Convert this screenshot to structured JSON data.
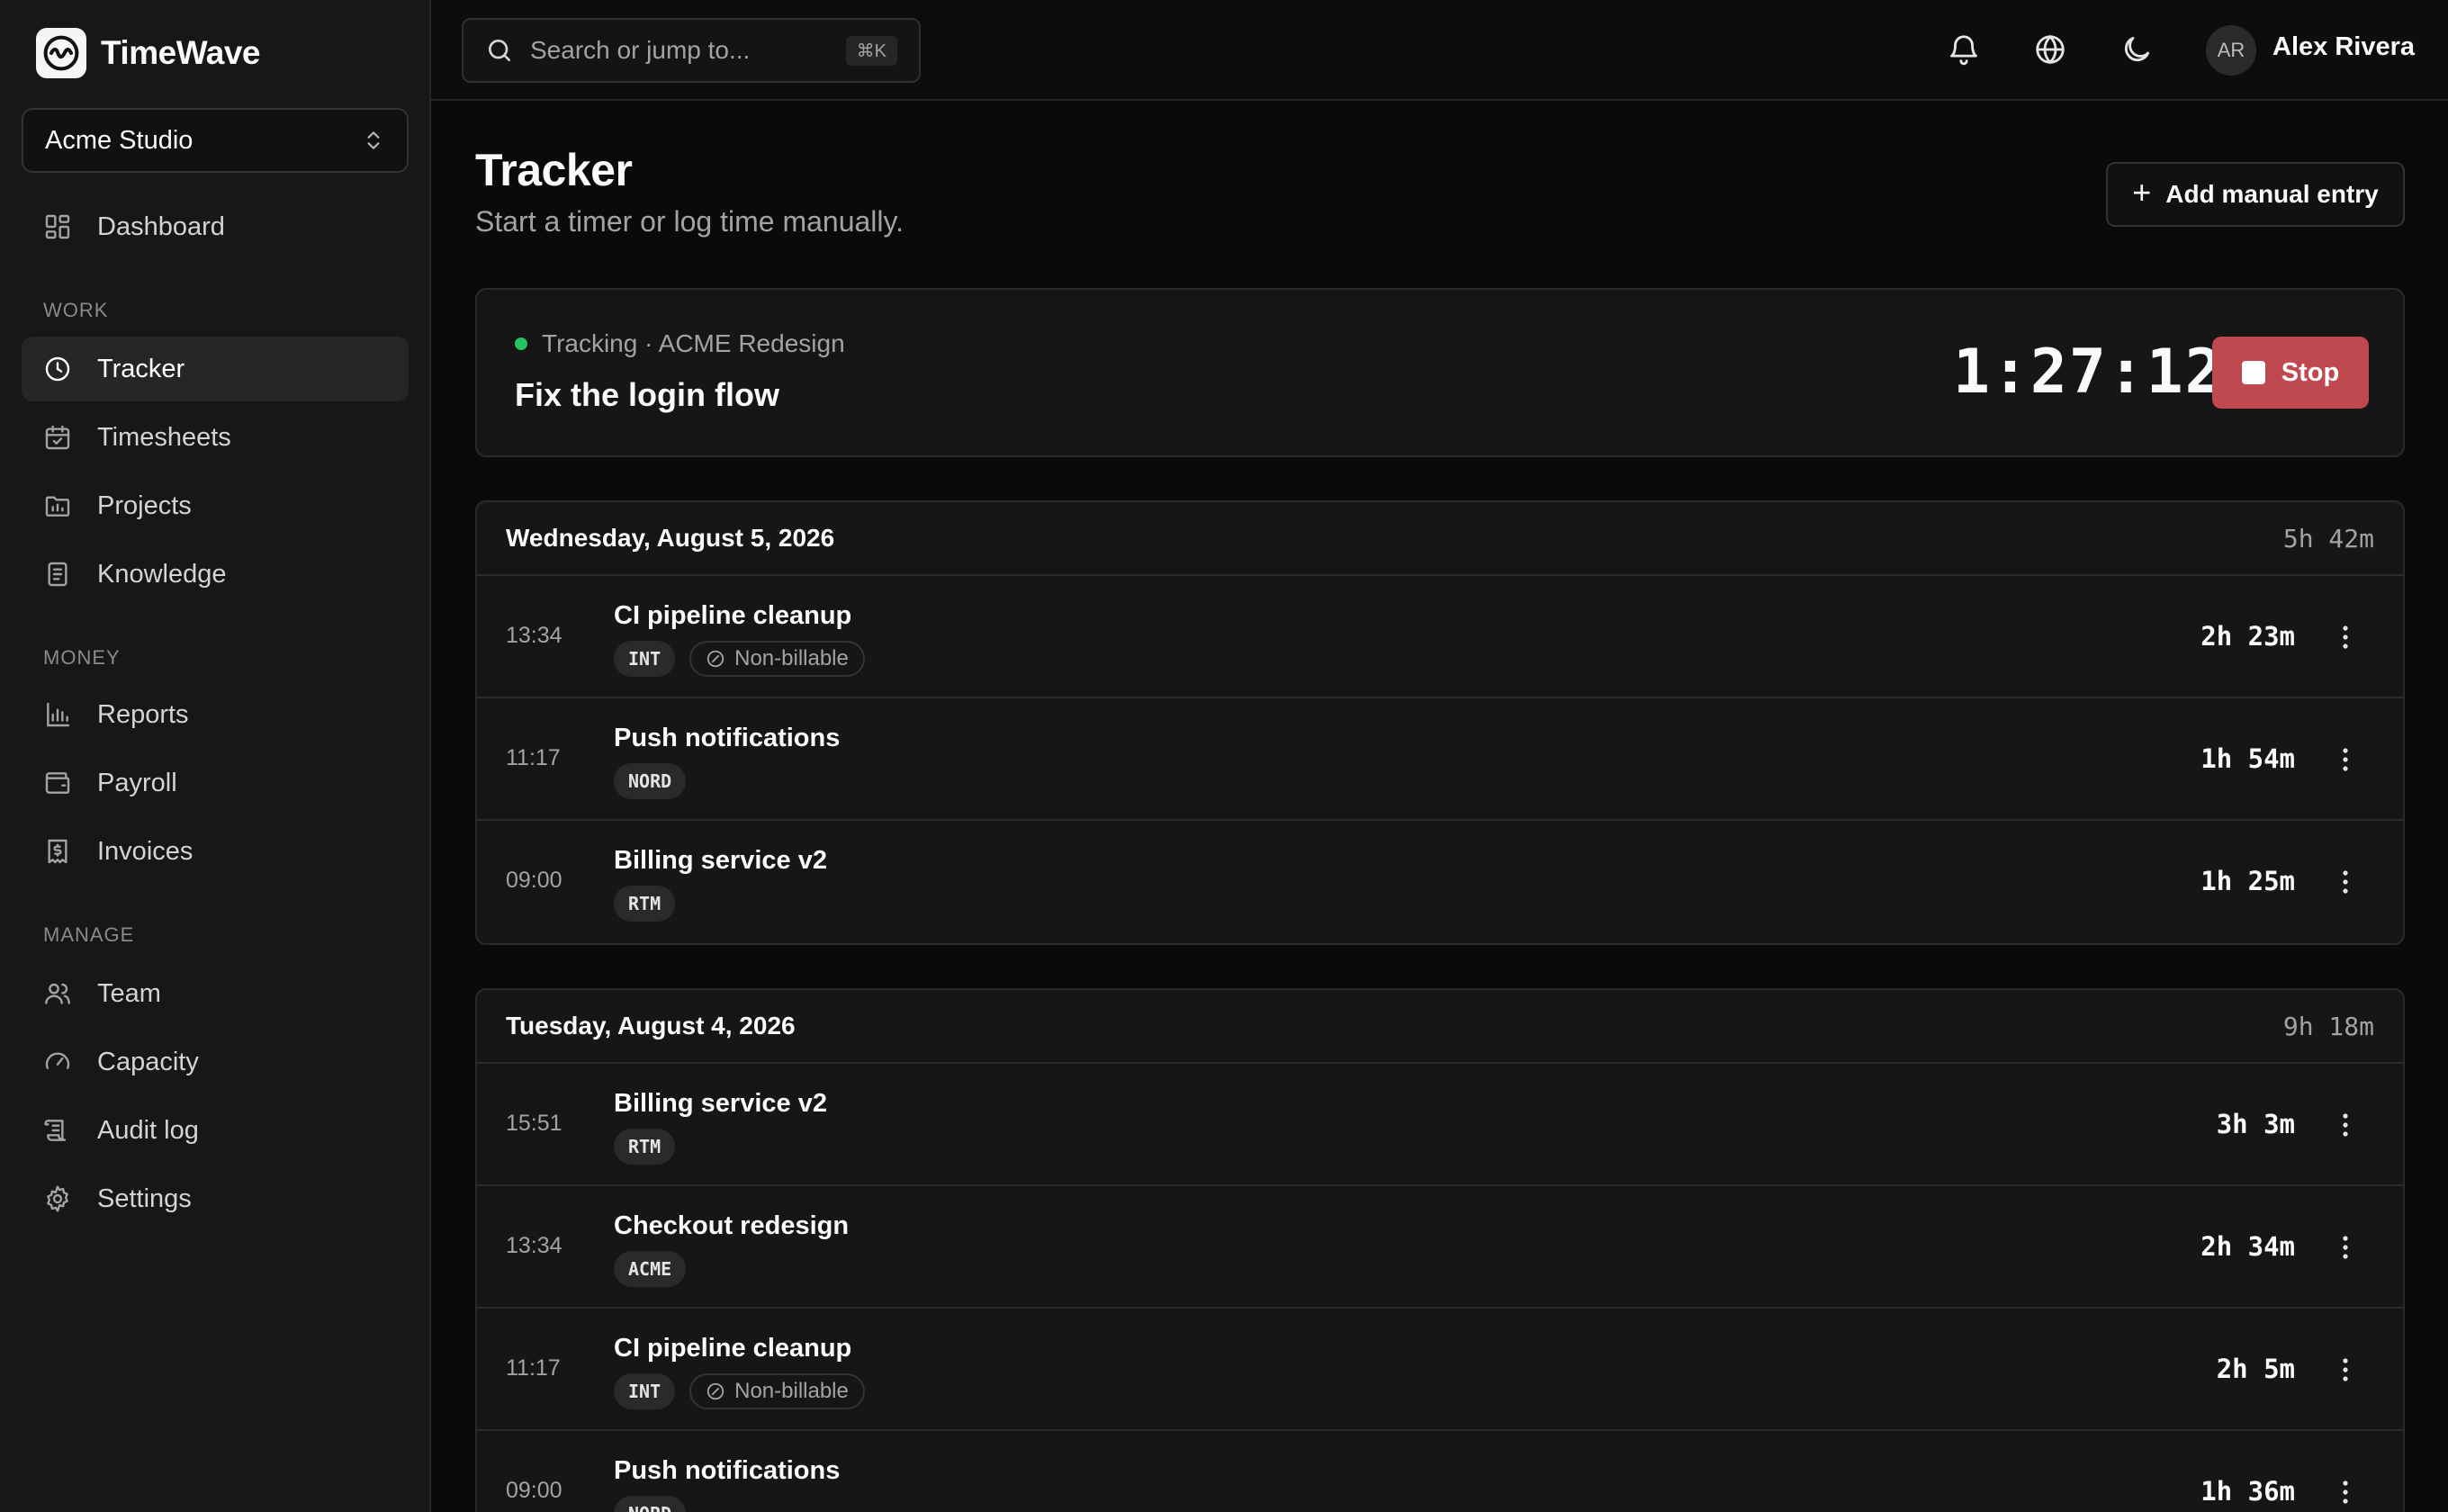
{
  "app": {
    "name": "TimeWave"
  },
  "org": {
    "name": "Acme Studio"
  },
  "sidebar": {
    "dashboard": "Dashboard",
    "sections": {
      "work": "WORK",
      "money": "MONEY",
      "manage": "MANAGE"
    },
    "work": [
      {
        "label": "Tracker",
        "icon": "clock-icon",
        "active": true
      },
      {
        "label": "Timesheets",
        "icon": "calendar-check-icon"
      },
      {
        "label": "Projects",
        "icon": "folder-chart-icon"
      },
      {
        "label": "Knowledge",
        "icon": "document-icon"
      }
    ],
    "money": [
      {
        "label": "Reports",
        "icon": "bar-chart-icon"
      },
      {
        "label": "Payroll",
        "icon": "wallet-icon"
      },
      {
        "label": "Invoices",
        "icon": "receipt-dollar-icon"
      }
    ],
    "manage": [
      {
        "label": "Team",
        "icon": "users-icon"
      },
      {
        "label": "Capacity",
        "icon": "gauge-icon"
      },
      {
        "label": "Audit log",
        "icon": "scroll-icon"
      },
      {
        "label": "Settings",
        "icon": "gear-icon"
      }
    ]
  },
  "topbar": {
    "search_placeholder": "Search or jump to...",
    "shortcut": "⌘K",
    "user_initials": "AR",
    "user_name": "Alex Rivera"
  },
  "page": {
    "title": "Tracker",
    "subtitle": "Start a timer or log time manually.",
    "add_button": "Add manual entry"
  },
  "tracker": {
    "status": "Tracking · ACME Redesign",
    "task": "Fix the login flow",
    "time": "1:27:12",
    "stop_label": "Stop"
  },
  "days": [
    {
      "date": "Wednesday, August 5, 2026",
      "total": "5h 42m",
      "entries": [
        {
          "time": "13:34",
          "name": "CI pipeline cleanup",
          "tag": "INT",
          "non_billable": "Non-billable",
          "duration": "2h 23m"
        },
        {
          "time": "11:17",
          "name": "Push notifications",
          "tag": "NORD",
          "duration": "1h 54m"
        },
        {
          "time": "09:00",
          "name": "Billing service v2",
          "tag": "RTM",
          "duration": "1h 25m"
        }
      ]
    },
    {
      "date": "Tuesday, August 4, 2026",
      "total": "9h 18m",
      "entries": [
        {
          "time": "15:51",
          "name": "Billing service v2",
          "tag": "RTM",
          "duration": "3h 3m"
        },
        {
          "time": "13:34",
          "name": "Checkout redesign",
          "tag": "ACME",
          "duration": "2h 34m"
        },
        {
          "time": "11:17",
          "name": "CI pipeline cleanup",
          "tag": "INT",
          "non_billable": "Non-billable",
          "duration": "2h 5m"
        },
        {
          "time": "09:00",
          "name": "Push notifications",
          "tag": "NORD",
          "duration": "1h 36m"
        }
      ]
    }
  ],
  "colors": {
    "accent_stop": "#c0484f",
    "tracking_dot": "#22c55e",
    "background": "#0a0a0a",
    "sidebar": "#171717"
  }
}
